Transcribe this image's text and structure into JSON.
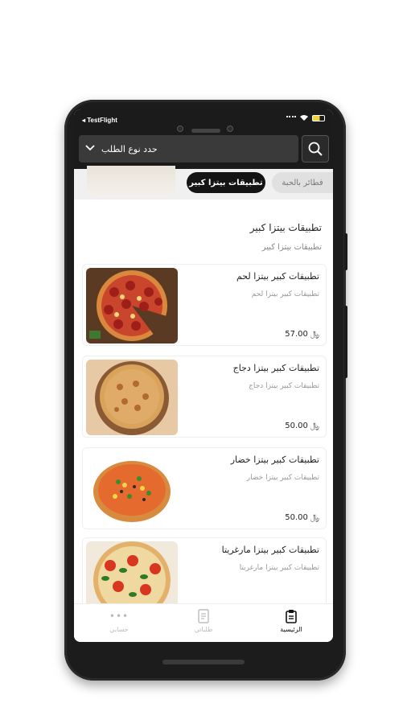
{
  "status": {
    "carrier": "◂ TestFlight"
  },
  "header": {
    "order_type_label": "حدد نوع الطلب",
    "search_icon": "search-icon"
  },
  "categories": {
    "active": "تطبيقات بيتزا كبير",
    "other": "فطائر بالحبة"
  },
  "section": {
    "title": "تطبيقات بيتزا كبير",
    "subtitle": "تطبيقات بيتزا كبير"
  },
  "products": [
    {
      "name": "تطبيقات كبير بيتزا لحم",
      "desc": "تطبيقات كبير بيتزا لحم",
      "price": "57.00",
      "currency": "﷼"
    },
    {
      "name": "تطبيقات كبير بيتزا دجاج",
      "desc": "تطبيقات كبير بيتزا دجاج",
      "price": "50.00",
      "currency": "﷼"
    },
    {
      "name": "تطبيقات كبير بيتزا خضار",
      "desc": "تطبيقات كبير بيتزا خضار",
      "price": "50.00",
      "currency": "﷼"
    },
    {
      "name": "تطبيقات كبير بيتزا مارغريتا",
      "desc": "تطبيقات كبير بيتزا مارغريتا",
      "price": "",
      "currency": ""
    }
  ],
  "tabbar": {
    "home": "الرئيسية",
    "orders": "طلباتي",
    "account": "حسابي"
  },
  "colors": {
    "dark": "#1b1b1b",
    "active_chip": "#141414",
    "muted": "#999999"
  }
}
